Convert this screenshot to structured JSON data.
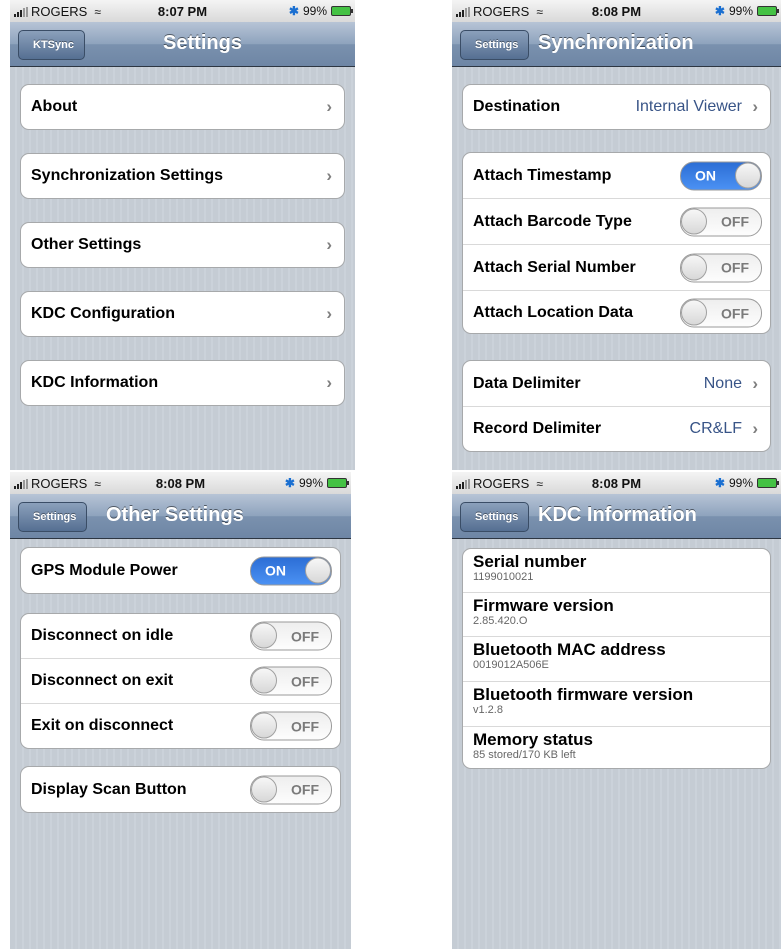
{
  "status": [
    {
      "carrier": "ROGERS",
      "time": "8:07 PM",
      "battery": "99%"
    },
    {
      "carrier": "ROGERS",
      "time": "8:08 PM",
      "battery": "99%"
    },
    {
      "carrier": "ROGERS",
      "time": "8:08 PM",
      "battery": "99%"
    },
    {
      "carrier": "ROGERS",
      "time": "8:08 PM",
      "battery": "99%"
    }
  ],
  "settings": {
    "back": "KTSync",
    "title": "Settings",
    "items": [
      {
        "label": "About"
      },
      {
        "label": "Synchronization Settings"
      },
      {
        "label": "Other Settings"
      },
      {
        "label": "KDC Configuration"
      },
      {
        "label": "KDC Information"
      }
    ]
  },
  "sync": {
    "back": "Settings",
    "title": "Synchronization",
    "destination": {
      "label": "Destination",
      "value": "Internal Viewer"
    },
    "toggles": [
      {
        "label": "Attach Timestamp",
        "state": "ON"
      },
      {
        "label": "Attach Barcode Type",
        "state": "OFF"
      },
      {
        "label": "Attach Serial Number",
        "state": "OFF"
      },
      {
        "label": "Attach Location Data",
        "state": "OFF"
      }
    ],
    "delimiters": [
      {
        "label": "Data Delimiter",
        "value": "None"
      },
      {
        "label": "Record Delimiter",
        "value": "CR&LF"
      }
    ]
  },
  "other": {
    "back": "Settings",
    "title": "Other Settings",
    "gps": {
      "label": "GPS Module Power",
      "state": "ON"
    },
    "toggles": [
      {
        "label": "Disconnect on idle",
        "state": "OFF"
      },
      {
        "label": "Disconnect on exit",
        "state": "OFF"
      },
      {
        "label": "Exit on disconnect",
        "state": "OFF"
      }
    ],
    "scan": {
      "label": "Display Scan Button",
      "state": "OFF"
    }
  },
  "kdc": {
    "back": "Settings",
    "title": "KDC Information",
    "items": [
      {
        "title": "Serial number",
        "value": "1199010021"
      },
      {
        "title": "Firmware version",
        "value": "2.85.420.O"
      },
      {
        "title": "Bluetooth MAC address",
        "value": "0019012A506E"
      },
      {
        "title": "Bluetooth firmware version",
        "value": "v1.2.8"
      },
      {
        "title": "Memory status",
        "value": "85 stored/170 KB left"
      }
    ]
  },
  "colors": {
    "switch_on": "#2c6ed5",
    "value_text": "#385487",
    "nav_bar": "#6e86a5"
  }
}
